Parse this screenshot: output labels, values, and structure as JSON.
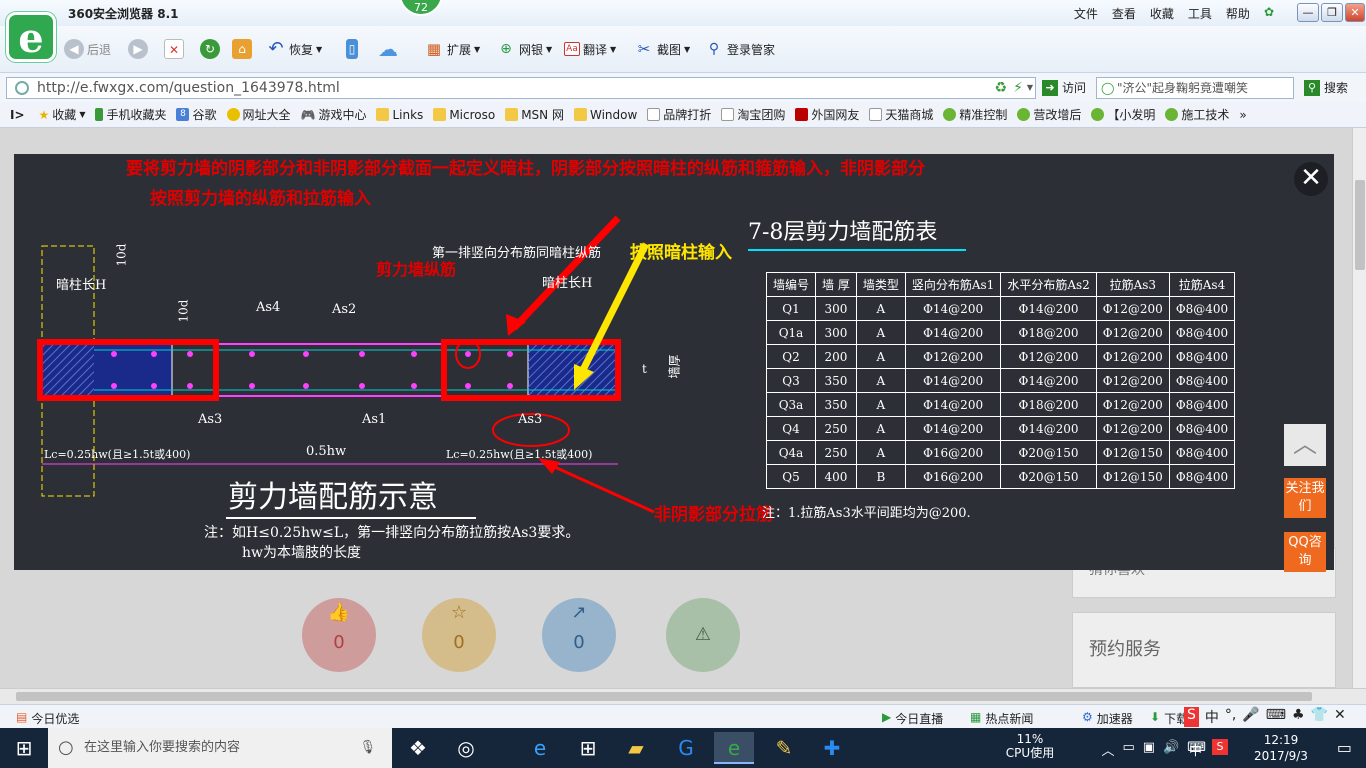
{
  "browser": {
    "title": "360安全浏览器 8.1",
    "badge": "72",
    "menu": [
      "文件",
      "查看",
      "收藏",
      "工具",
      "帮助"
    ],
    "toolbar": {
      "back": "后退",
      "restore": "恢复",
      "extend": "扩展",
      "bank": "网银",
      "translate": "翻译",
      "screenshot": "截图",
      "login": "登录管家"
    },
    "url": "http://e.fwxgx.com/question_1643978.html",
    "visit": "访问",
    "search_text": "\"济公\"起身鞠躬竟遭嘲笑",
    "search_btn": "搜索",
    "bookmarks": [
      "收藏",
      "手机收藏夹",
      "谷歌",
      "网址大全",
      "游戏中心",
      "Links",
      "Microso",
      "MSN 网",
      "Window",
      "品牌打折",
      "淘宝团购",
      "外国网友",
      "天猫商城",
      "精准控制",
      "营改增后",
      "【小发明",
      "施工技术"
    ]
  },
  "overlay": {
    "note_line1": "要将剪力墙的阴影部分和非阴影部分截面一起定义暗柱，阴影部分按照暗柱的纵筋和箍筋输入，非阴影部分",
    "note_line2": "按照剪力墙的纵筋和拉筋输入",
    "label_longitudinal": "剪力墙纵筋",
    "label_dark_column": "按照暗柱输入",
    "label_non_shadow": "非阴影部分拉筋",
    "drawing": {
      "first_row": "第一排竖向分布筋同暗柱纵筋",
      "dark_col_left": "暗柱长H",
      "dark_col_right": "暗柱长H",
      "d10a": "10d",
      "d10b": "10d",
      "as4": "As4",
      "as2": "As2",
      "as3a": "As3",
      "as1": "As1",
      "as3b": "As3",
      "lc_left": "Lc=0.25hw(且≥1.5t或400)",
      "hw": "0.5hw",
      "lc_right": "Lc=0.25hw(且≥1.5t或400)",
      "t": "t",
      "wall_thk": "墙厚",
      "caption": "剪力墙配筋示意",
      "footnote1": "注：如H≤0.25hw≤L，第一排竖向分布筋拉筋按As3要求。",
      "footnote2": "hw为本墙肢的长度"
    },
    "table_title": "7-8层剪力墙配筋表",
    "table_headers": [
      "墙编号",
      "墙 厚",
      "墙类型",
      "竖向分布筋As1",
      "水平分布筋As2",
      "拉筋As3",
      "拉筋As4"
    ],
    "table_rows": [
      [
        "Q1",
        "300",
        "A",
        "Φ14@200",
        "Φ14@200",
        "Φ12@200",
        "Φ8@400"
      ],
      [
        "Q1a",
        "300",
        "A",
        "Φ14@200",
        "Φ18@200",
        "Φ12@200",
        "Φ8@400"
      ],
      [
        "Q2",
        "200",
        "A",
        "Φ12@200",
        "Φ12@200",
        "Φ12@200",
        "Φ8@400"
      ],
      [
        "Q3",
        "350",
        "A",
        "Φ14@200",
        "Φ14@200",
        "Φ12@200",
        "Φ8@400"
      ],
      [
        "Q3a",
        "350",
        "A",
        "Φ14@200",
        "Φ18@200",
        "Φ12@200",
        "Φ8@400"
      ],
      [
        "Q4",
        "250",
        "A",
        "Φ14@200",
        "Φ14@200",
        "Φ12@200",
        "Φ8@400"
      ],
      [
        "Q4a",
        "250",
        "A",
        "Φ16@200",
        "Φ20@150",
        "Φ12@150",
        "Φ8@400"
      ],
      [
        "Q5",
        "400",
        "B",
        "Φ16@200",
        "Φ20@150",
        "Φ12@150",
        "Φ8@400"
      ]
    ],
    "table_note": "注：1.拉筋As3水平间距均为@200."
  },
  "page": {
    "counts": [
      "0",
      "0",
      "0"
    ],
    "side_follow": "关注我们",
    "side_qq": "QQ咨询",
    "booking": "预约服务",
    "bg_text": "猜你喜欢"
  },
  "status": {
    "left": "今日优选",
    "items": [
      "今日直播",
      "热点新闻",
      "加速器",
      "下载"
    ]
  },
  "taskbar": {
    "search_placeholder": "在这里输入你要搜索的内容",
    "cpu": "11%",
    "cpu_label": "CPU使用",
    "ime": "中",
    "time": "12:19",
    "date": "2017/9/3"
  }
}
